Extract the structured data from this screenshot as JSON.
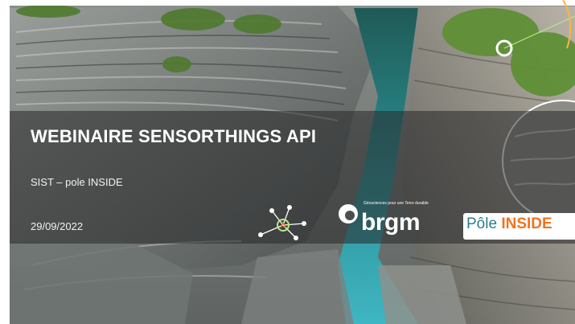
{
  "slide": {
    "title": "WEBINAIRE SENSORTHINGS API",
    "subtitle": "SIST – pole INSIDE",
    "date": "29/09/2022"
  },
  "logos": {
    "brgm_tagline": "Géosciences pour une Terre durable",
    "brgm_word": "brgm",
    "pole_part1": "Pôle ",
    "pole_part2": "INSIDE"
  },
  "colors": {
    "band": "#28282a",
    "pole_teal": "#2c7f8a",
    "pole_orange": "#f0731e",
    "network_green": "#b8e986"
  },
  "icons": [
    "network-sensor-icon",
    "brgm-logo",
    "pole-inside-logo"
  ]
}
